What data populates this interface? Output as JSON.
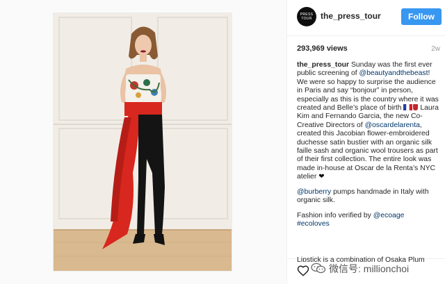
{
  "post": {
    "username": "the_press_tour",
    "avatar_text": "PRESS TOUR",
    "follow_label": "Follow",
    "views": "293,969 views",
    "time_ago": "2w"
  },
  "caption": {
    "author": "the_press_tour",
    "p1_a": " Sunday was the first ever public screening of ",
    "mention_1": "@beautyandthebeast",
    "p1_b": "! We were so happy to surprise the audience in Paris and say “bonjour” in person, especially as this is the country where it was created and Belle’s place of birth ",
    "p1_c": " Laura Kim and Fernando Garcia, the new Co-Creative Directors of ",
    "mention_2": "@oscardelarenta",
    "p1_d": ", created this Jacobian flower-embroidered duchesse satin bustier with an organic silk faille sash and organic wool trousers as part of their first collection. The entire look was made in-house at Oscar de la Renta’s NYC atelier ",
    "p2_mention": "@burberry",
    "p2_text": " pumps handmade in Italy with organic silk.",
    "p3_text": "Fashion info verified by ",
    "p3_mention": "@ecoage",
    "p3_tag": "#ecoloves",
    "cut_text": "Lipstick is a combination of Osaka Plum"
  },
  "footer": {
    "watermark": "微信号: millionchoi"
  },
  "icons": {
    "like": "heart-outline-icon",
    "wechat": "wechat-icon",
    "flag": "france-flag-icon",
    "badge": "ribbon-badge-icon"
  },
  "colors": {
    "follow_button": "#3897f0",
    "mention_link": "#003569",
    "sash_red": "#d8271e"
  }
}
